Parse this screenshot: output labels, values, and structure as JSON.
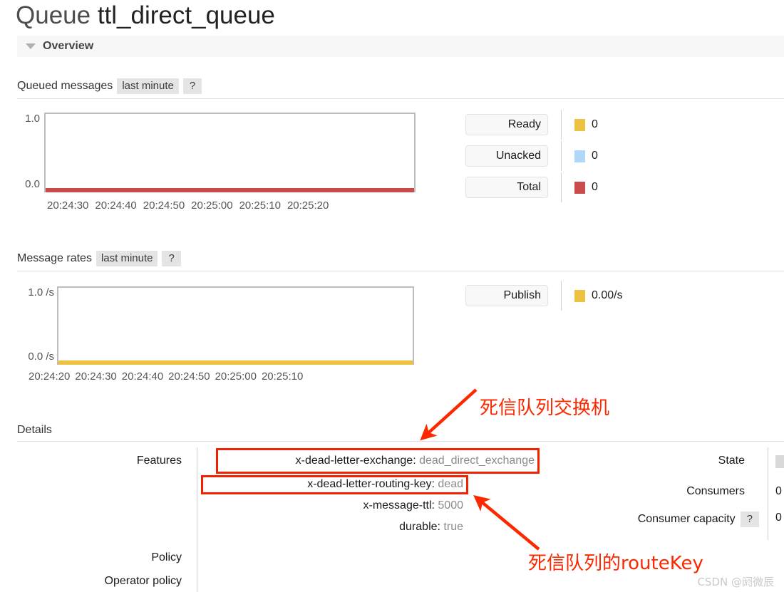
{
  "page": {
    "title_prefix": "Queue",
    "queue_name": "ttl_direct_queue"
  },
  "overview": {
    "label": "Overview",
    "caret_icon": "triangle-down-icon"
  },
  "queued_messages": {
    "title": "Queued messages",
    "period_chip": "last minute",
    "help_chip": "?",
    "legend": [
      {
        "label": "Ready",
        "value": "0",
        "color": "#edc240"
      },
      {
        "label": "Unacked",
        "value": "0",
        "color": "#afd8f8"
      },
      {
        "label": "Total",
        "value": "0",
        "color": "#cb4b4b"
      }
    ]
  },
  "message_rates": {
    "title": "Message rates",
    "period_chip": "last minute",
    "help_chip": "?",
    "legend": [
      {
        "label": "Publish",
        "value": "0.00/s",
        "color": "#edc240"
      }
    ]
  },
  "details": {
    "title": "Details",
    "features_label": "Features",
    "policy_label": "Policy",
    "operator_policy_label": "Operator policy",
    "features": [
      {
        "key": "x-dead-letter-exchange:",
        "value": "dead_direct_exchange"
      },
      {
        "key": "x-dead-letter-routing-key:",
        "value": "dead"
      },
      {
        "key": "x-message-ttl:",
        "value": "5000"
      },
      {
        "key": "durable:",
        "value": "true"
      }
    ],
    "state_label": "State",
    "state_value": "",
    "consumers_label": "Consumers",
    "consumers_value": "0",
    "consumer_capacity_label": "Consumer capacity",
    "consumer_capacity_help": "?",
    "consumer_capacity_value": "0"
  },
  "annotations": {
    "exchange_note": "死信队列交换机",
    "routing_key_note": "死信队列的routeKey",
    "color": "#fc2800"
  },
  "watermark": "CSDN @阏微辰",
  "chart_data": [
    {
      "type": "line",
      "title": "Queued messages",
      "subtitle": "last minute",
      "xlabel": "",
      "ylabel": "",
      "ylim": [
        0.0,
        1.0
      ],
      "ytick_labels": [
        "1.0",
        "0.0"
      ],
      "xtick_labels": [
        "20:24:30",
        "20:24:40",
        "20:24:50",
        "20:25:00",
        "20:25:10",
        "20:25:20"
      ],
      "grid": false,
      "legend_position": "right",
      "series": [
        {
          "name": "Ready",
          "color": "#edc240",
          "values": [
            0,
            0,
            0,
            0,
            0,
            0
          ]
        },
        {
          "name": "Unacked",
          "color": "#afd8f8",
          "values": [
            0,
            0,
            0,
            0,
            0,
            0
          ]
        },
        {
          "name": "Total",
          "color": "#cb4b4b",
          "values": [
            0,
            0,
            0,
            0,
            0,
            0
          ]
        }
      ]
    },
    {
      "type": "line",
      "title": "Message rates",
      "subtitle": "last minute",
      "xlabel": "",
      "ylabel": "",
      "ylim": [
        0.0,
        1.0
      ],
      "ytick_labels": [
        "1.0 /s",
        "0.0 /s"
      ],
      "xtick_labels": [
        "20:24:20",
        "20:24:30",
        "20:24:40",
        "20:24:50",
        "20:25:00",
        "20:25:10"
      ],
      "grid": false,
      "legend_position": "right",
      "series": [
        {
          "name": "Publish",
          "color": "#edc240",
          "values": [
            0,
            0,
            0,
            0,
            0,
            0
          ]
        }
      ]
    }
  ]
}
